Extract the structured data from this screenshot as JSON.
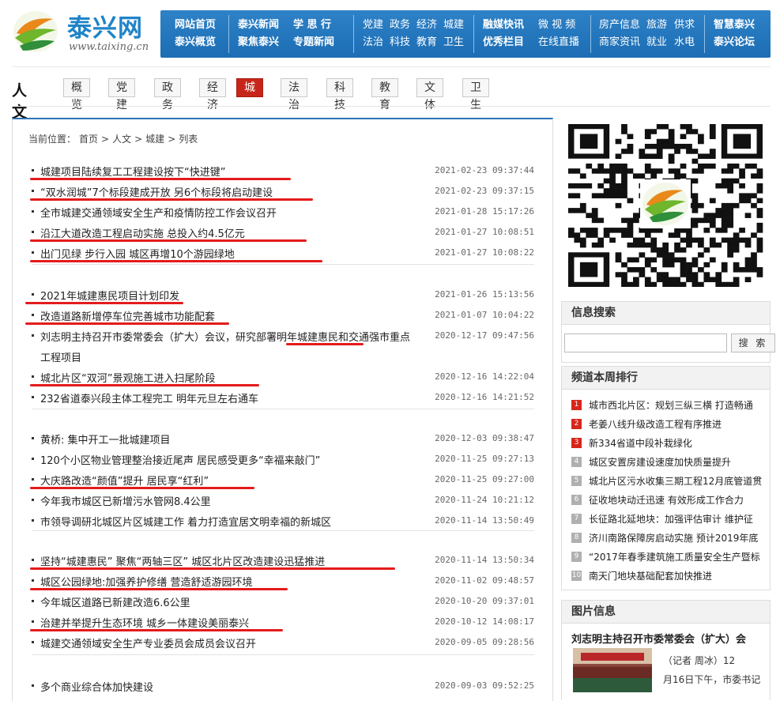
{
  "site": {
    "logo_cn": "泰兴网",
    "logo_en": "www.taixing.cn"
  },
  "nav": {
    "col1": [
      "网站首页",
      "泰兴概览"
    ],
    "col2": [
      "泰兴新闻",
      "聚焦泰兴"
    ],
    "col3": [
      "学 思 行",
      "专题新闻"
    ],
    "col4a": [
      "党建",
      "法治"
    ],
    "col4b": [
      "政务",
      "科技"
    ],
    "col4c": [
      "经济",
      "教育"
    ],
    "col4d": [
      "城建",
      "卫生"
    ],
    "col5": [
      "融媒快讯",
      "优秀栏目"
    ],
    "col6": [
      "微 视 频",
      "在线直播"
    ],
    "col7a": [
      "房产信息",
      "商家资讯"
    ],
    "col7b": [
      "旅游",
      "就业"
    ],
    "col7c": [
      "供求",
      "水电"
    ],
    "col8": [
      "智慧泰兴",
      "泰兴论坛"
    ]
  },
  "categories": {
    "title": "人文",
    "tabs": [
      "概览",
      "党建",
      "政务",
      "经济",
      "城建",
      "法治",
      "科技",
      "教育",
      "文体",
      "卫生"
    ],
    "active": "城建"
  },
  "breadcrumb": [
    "当前位置：",
    "首页",
    ">",
    "人文",
    ">",
    "城建",
    ">",
    "列表"
  ],
  "news_groups": [
    [
      {
        "title": "城建项目陆续复工工程建设按下“快进键”",
        "date": "2021-02-23 09:37:44"
      },
      {
        "title": "“双水润城”7个标段建成开放 另6个标段将启动建设",
        "date": "2021-02-23 09:37:15"
      },
      {
        "title": "全市城建交通领域安全生产和疫情防控工作会议召开",
        "date": "2021-01-28 15:17:26"
      },
      {
        "title": "沿江大道改造工程启动实施  总投入约4.5亿元",
        "date": "2021-01-27 10:08:51"
      },
      {
        "title": "出门见绿 步行入园  城区再增10个游园绿地",
        "date": "2021-01-27 10:08:22"
      }
    ],
    [
      {
        "title": "2021年城建惠民项目计划印发",
        "date": "2021-01-26 15:13:56"
      },
      {
        "title": "改造道路新增停车位完善城市功能配套",
        "date": "2021-01-07 10:04:22"
      },
      {
        "title": "刘志明主持召开市委常委会（扩大）会议，研究部署明年城建惠民和交通强市重点",
        "title2": "工程项目",
        "date": "2020-12-17 09:47:56"
      },
      {
        "title": "城北片区“双河”景观施工进入扫尾阶段",
        "date": "2020-12-16 14:22:04"
      },
      {
        "title": "232省道泰兴段主体工程完工  明年元旦左右通车",
        "date": "2020-12-16 14:21:52"
      }
    ],
    [
      {
        "title": "黄桥:  集中开工一批城建项目",
        "date": "2020-12-03 09:38:47"
      },
      {
        "title": "120个小区物业管理整治接近尾声  居民感受更多“幸福来敲门”",
        "date": "2020-11-25 09:27:13"
      },
      {
        "title": "大庆路改造“颜值”提升  居民享“红利”",
        "date": "2020-11-25 09:27:00"
      },
      {
        "title": "今年我市城区已新增污水管网8.4公里",
        "date": "2020-11-24 10:21:12"
      },
      {
        "title": "市领导调研北城区片区城建工作  着力打造宜居文明幸福的新城区",
        "date": "2020-11-14 13:50:49"
      }
    ],
    [
      {
        "title": "坚持“城建惠民” 聚焦“两轴三区”  城区北片区改造建设迅猛推进",
        "date": "2020-11-14 13:50:34"
      },
      {
        "title": "城区公园绿地:加强养护修缮 营造舒适游园环境",
        "date": "2020-11-02 09:48:57"
      },
      {
        "title": "今年城区道路已新建改造6.6公里",
        "date": "2020-10-20 09:37:01"
      },
      {
        "title": "治建并举提升生态环境  城乡一体建设美丽泰兴",
        "date": "2020-10-12 14:08:17"
      },
      {
        "title": "城建交通领域安全生产专业委员会成员会议召开",
        "date": "2020-09-05 09:28:56"
      }
    ],
    [
      {
        "title": "多个商业综合体加快建设",
        "date": "2020-09-03 09:52:25"
      }
    ]
  ],
  "search": {
    "title": "信息搜索",
    "button": "搜 索",
    "placeholder": ""
  },
  "ranking": {
    "title": "频道本周排行",
    "items": [
      "城市西北片区：规划三纵三横 打造畅通",
      "老姜八线升级改造工程有序推进",
      "新334省道中段补栽绿化",
      "城区安置房建设速度加快质量提升",
      "城北片区污水收集三期工程12月底管道贯",
      "征收地块动迁迅速  有效形成工作合力",
      "长征路北延地块：加强评估审计 维护征",
      "济川南路保障房启动实施 预计2019年底",
      "“2017年春季建筑施工质量安全生产暨标",
      "南天门地块基础配套加快推进"
    ]
  },
  "pictures": {
    "title": "图片信息",
    "headline": "刘志明主持召开市委常委会（扩大）会",
    "summary_lines": [
      "（记者  周冰）12",
      "月16日下午，市委书记"
    ]
  },
  "colors": {
    "nav_blue": "#1f74bb",
    "active_red": "#c6261a",
    "underline_red": "#e41b1b"
  }
}
